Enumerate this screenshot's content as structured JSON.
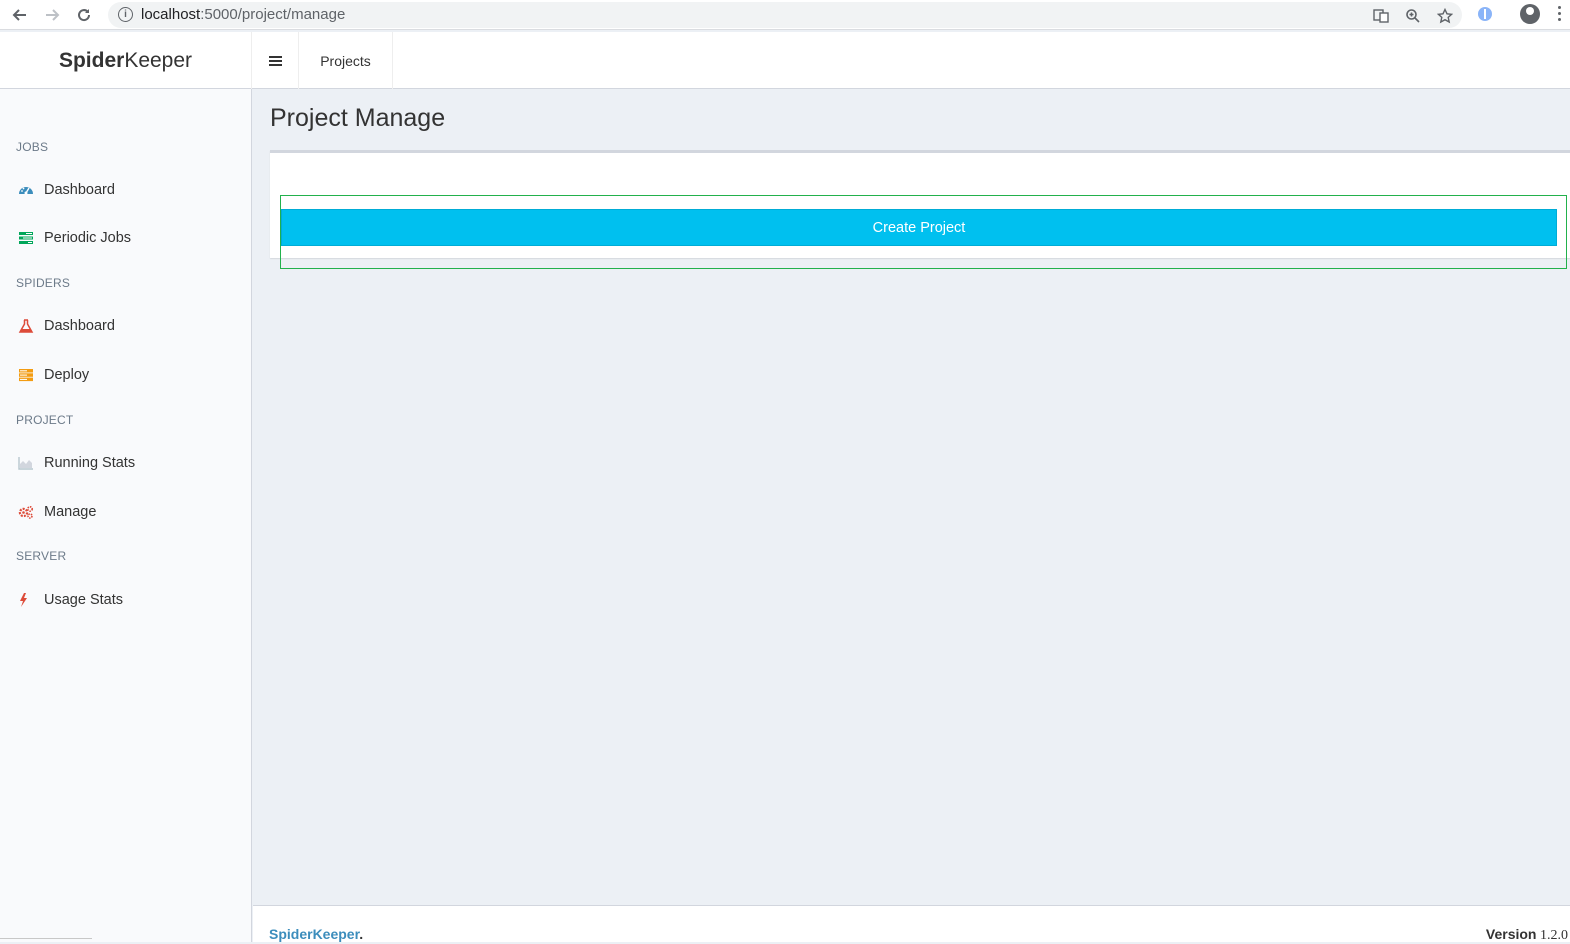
{
  "browser": {
    "url_host": "localhost",
    "url_path": ":5000/project/manage"
  },
  "header": {
    "logo_bold": "Spider",
    "logo_light": "Keeper",
    "nav_projects": "Projects"
  },
  "sidebar": {
    "sections": [
      {
        "title": "JOBS"
      },
      {
        "title": "SPIDERS"
      },
      {
        "title": "PROJECT"
      },
      {
        "title": "SERVER"
      }
    ],
    "items": [
      {
        "label": "Dashboard",
        "icon": "dashboard-icon",
        "color": "#3c8dbc"
      },
      {
        "label": "Periodic Jobs",
        "icon": "tasks-icon",
        "color": "#00a65a"
      },
      {
        "label": "Dashboard",
        "icon": "flask-icon",
        "color": "#dd4b39"
      },
      {
        "label": "Deploy",
        "icon": "server-icon",
        "color": "#f39c12"
      },
      {
        "label": "Running Stats",
        "icon": "area-chart-icon",
        "color": "#b8c7ce"
      },
      {
        "label": "Manage",
        "icon": "gears-icon",
        "color": "#dd4b39"
      },
      {
        "label": "Usage Stats",
        "icon": "bolt-icon",
        "color": "#dd4b39"
      }
    ]
  },
  "main": {
    "title": "Project Manage",
    "create_button": "Create Project"
  },
  "footer": {
    "brand": "SpiderKeeper",
    "brand_dot": ".",
    "version_label": "Version",
    "version_value": "1.2.0"
  },
  "colors": {
    "accent": "#00c0ef",
    "link": "#3c8dbc",
    "content_bg": "#ecf0f5"
  }
}
